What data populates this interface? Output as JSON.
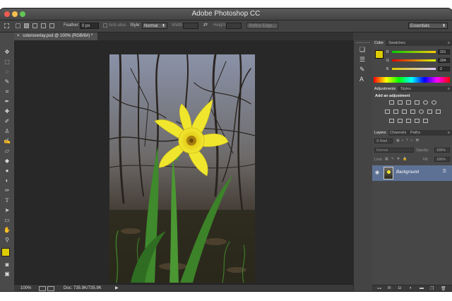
{
  "window": {
    "title": "Adobe Photoshop CC"
  },
  "options_bar": {
    "feather_label": "Feather:",
    "feather_value": "0 px",
    "anti_alias_label": "Anti-alias",
    "style_label": "Style:",
    "style_value": "Normal",
    "width_label": "Width:",
    "height_label": "Height:",
    "refine_edge_label": "Refine Edge...",
    "workspace_value": "Essentials"
  },
  "document": {
    "tab_label": "coloroverlay.psd @ 100% (RGB/8#) *"
  },
  "status_bar": {
    "zoom": "100%",
    "doc_info": "Doc: 735.9K/735.9K"
  },
  "color_panel": {
    "tabs": [
      "Color",
      "Swatches"
    ],
    "r_label": "R",
    "r_value": "221",
    "g_label": "G",
    "g_value": "204",
    "b_label": "B",
    "b_value": "2",
    "foreground_color": "#ddcc02"
  },
  "adjustments_panel": {
    "tabs": [
      "Adjustments",
      "Styles"
    ],
    "heading": "Add an adjustment"
  },
  "layers_panel": {
    "tabs": [
      "Layers",
      "Channels",
      "Paths"
    ],
    "kind_label": "Kind",
    "blend_mode": "Normal",
    "opacity_label": "Opacity:",
    "opacity_value": "100%",
    "lock_label": "Lock:",
    "fill_label": "Fill:",
    "fill_value": "100%",
    "layers": [
      {
        "name": "Background"
      }
    ],
    "bottom_fx_label": "fx"
  },
  "colors": {
    "accent_selection": "#5d7195",
    "flower": "#f0e62e",
    "stem": "#3f8a2c"
  }
}
